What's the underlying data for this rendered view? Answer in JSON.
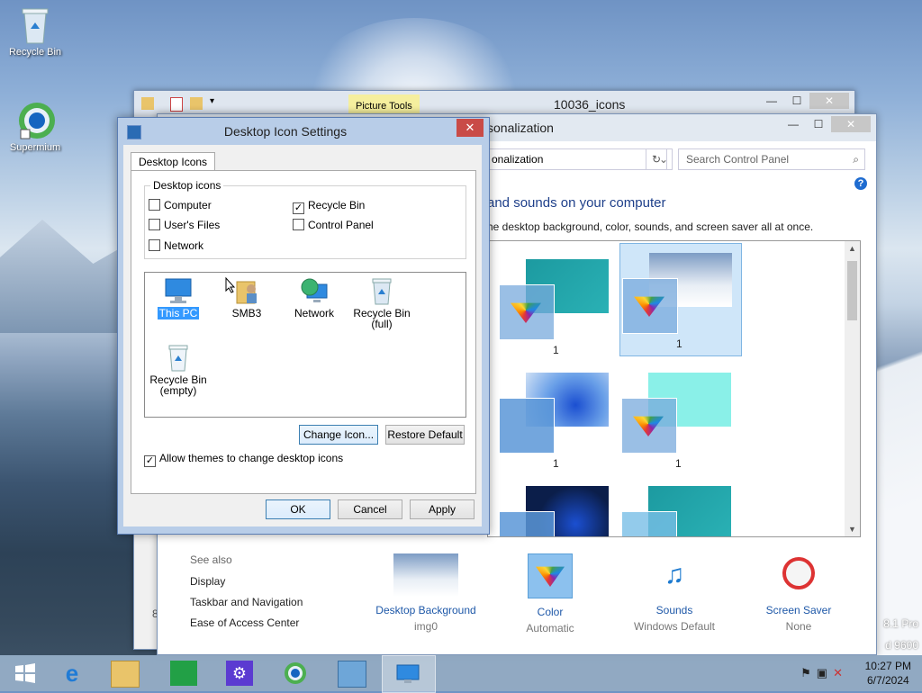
{
  "desktop": {
    "icons": [
      {
        "label": "Recycle Bin"
      },
      {
        "label": "Supermium"
      }
    ]
  },
  "explorer": {
    "ribbon_context": "Picture Tools",
    "title": "10036_icons"
  },
  "personalization": {
    "title_partial": "sonalization",
    "address": "onalization",
    "search_placeholder": "Search Control Panel",
    "help": "?",
    "heading": "and sounds on your computer",
    "subheading": "he desktop background, color, sounds, and screen saver all at once.",
    "themes": [
      {
        "count": "1"
      },
      {
        "count": "1"
      },
      {
        "count": "1"
      },
      {
        "count": "1"
      }
    ],
    "see_also": {
      "label": "See also",
      "links": [
        "Display",
        "Taskbar and Navigation",
        "Ease of Access Center"
      ]
    },
    "bottom": [
      {
        "title": "Desktop Background",
        "sub": "img0"
      },
      {
        "title": "Color",
        "sub": "Automatic"
      },
      {
        "title": "Sounds",
        "sub": "Windows Default"
      },
      {
        "title": "Screen Saver",
        "sub": "None"
      }
    ],
    "watermark_line1": "8.1 Pro",
    "watermark_line2": "d 9600",
    "left_char": "8"
  },
  "dialog": {
    "title": "Desktop Icon Settings",
    "close": "✕",
    "tab": "Desktop Icons",
    "group_label": "Desktop icons",
    "checkboxes": [
      {
        "label": "Computer",
        "checked": false
      },
      {
        "label": "Recycle Bin",
        "checked": true
      },
      {
        "label": "User's Files",
        "checked": false
      },
      {
        "label": "Control Panel",
        "checked": false
      },
      {
        "label": "Network",
        "checked": false
      }
    ],
    "icons": [
      {
        "label": "This PC"
      },
      {
        "label": "SMB3"
      },
      {
        "label": "Network"
      },
      {
        "label": "Recycle Bin",
        "label2": "(full)"
      },
      {
        "label": "Recycle Bin",
        "label2": "(empty)"
      }
    ],
    "change_icon": "Change Icon...",
    "restore_default": "Restore Default",
    "allow_themes": "Allow themes to change desktop icons",
    "allow_themes_checked": true,
    "ok": "OK",
    "cancel": "Cancel",
    "apply": "Apply"
  },
  "taskbar": {
    "time": "10:27 PM",
    "date": "6/7/2024"
  },
  "colors": {
    "link": "#1e58a8",
    "heading": "#1e3f8a",
    "selection": "#3399ff",
    "close_red": "#c94b47"
  }
}
